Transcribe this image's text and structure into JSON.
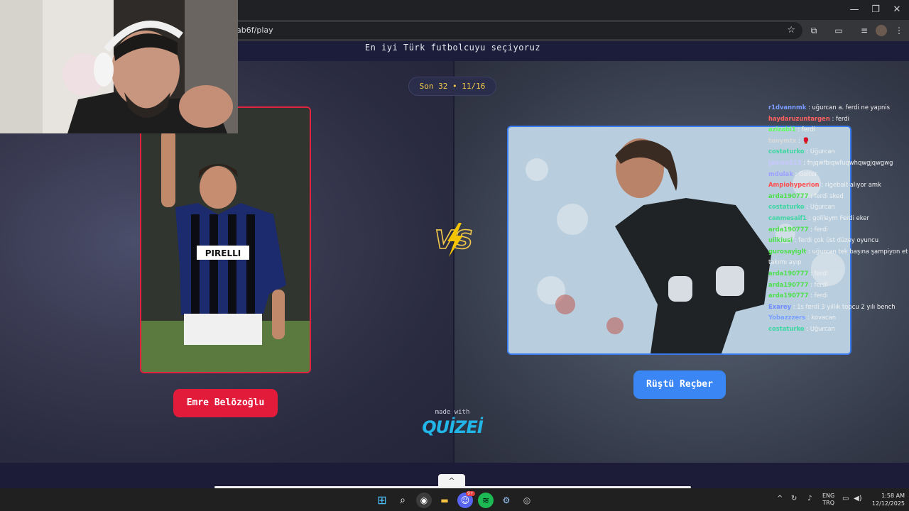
{
  "browser": {
    "url": "lab6f/play",
    "window_controls": {
      "minimize": "—",
      "restore": "❐",
      "close": "✕"
    }
  },
  "page": {
    "heading": "En iyi Türk futbolcuyu seçiyoruz",
    "round_label": "Son 32 • 11/16",
    "left_player": {
      "name": "Emre Belözoğlu",
      "accent": "#e31b3b"
    },
    "right_player": {
      "name": "Rüştü Reçber",
      "accent": "#3a86f5"
    },
    "vs_text": "VS",
    "footer_made_with": "made with",
    "footer_brand": "QUİZEİ"
  },
  "chat": [
    {
      "user": "r1dvannmk",
      "color": "#7a9cff",
      "msg": "uğurcan a. ferdi ne yapnis"
    },
    {
      "user": "haydaruzuntargen",
      "color": "#ff6060",
      "msg": "ferdi"
    },
    {
      "user": "azizabi1",
      "color": "#5dff5d",
      "msg": "ferdi"
    },
    {
      "user": "tonymtx",
      "color": "#d9d9d9",
      "msg": "🥊"
    },
    {
      "user": "costaturko",
      "color": "#3dd6a0",
      "msg": "Uğurcan"
    },
    {
      "user": "JameeS13",
      "color": "#c8c8ff",
      "msg": "fnjqwfbiqwfuqwhqwgjqwgwg"
    },
    {
      "user": "mdulak",
      "color": "#9aa0ff",
      "msg": "Gelter"
    },
    {
      "user": "Ampiohyperion",
      "color": "#ff5050",
      "msg": "rigebait alıyor amk"
    },
    {
      "user": "arda190777",
      "color": "#4ee04e",
      "msg": "ferdi sked"
    },
    {
      "user": "costaturko",
      "color": "#3dd6a0",
      "msg": "Uğurcan"
    },
    {
      "user": "canmesaif1",
      "color": "#3dd6a0",
      "msg": "gollleym Ferdi eker"
    },
    {
      "user": "arda190777",
      "color": "#4ee04e",
      "msg": "ferdi"
    },
    {
      "user": "uilkiusi",
      "color": "#4ee04e",
      "msg": "ferdi çok üst düzey oyuncu"
    },
    {
      "user": "gurosayiglt",
      "color": "#4ee04e",
      "msg": "uğurcan tek başına şampiyon etti"
    },
    {
      "user": "",
      "color": "#ffffff",
      "msg": "takımı ayıp"
    },
    {
      "user": "arda190777",
      "color": "#4ee04e",
      "msg": "ferdi"
    },
    {
      "user": "arda190777",
      "color": "#4ee04e",
      "msg": "ferdi"
    },
    {
      "user": "arda190777",
      "color": "#4ee04e",
      "msg": "ferdi"
    },
    {
      "user": "Exarey",
      "color": "#6f8cff",
      "msg": "1s ferdi 3 yıllık topcu 2 yılı bench"
    },
    {
      "user": "Yobazzzers",
      "color": "#7aa0ff",
      "msg": "kovacan"
    },
    {
      "user": "costaturko",
      "color": "#3dd6a0",
      "msg": "Uğurcan"
    }
  ],
  "taskbar": {
    "lang_top": "ENG",
    "lang_bottom": "TRQ",
    "time": "1:58 AM",
    "date": "12/12/2025",
    "discord_badge": "9+"
  }
}
